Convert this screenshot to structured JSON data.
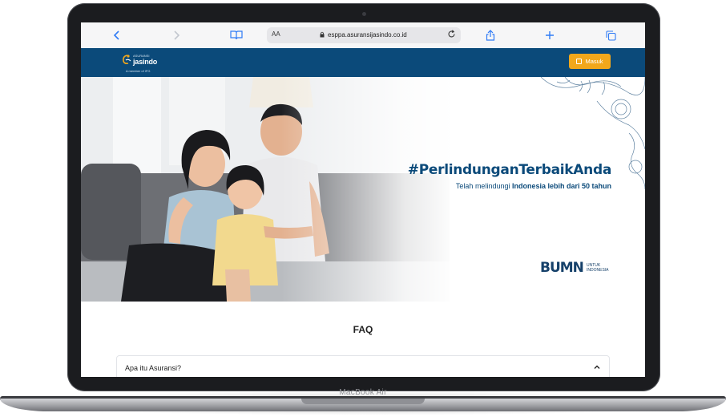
{
  "device": {
    "label": "MacBook Air"
  },
  "browser": {
    "aa_label": "AA",
    "url": "esppa.asuransijasindo.co.id",
    "icons": [
      "back-icon",
      "forward-icon",
      "bookmarks-icon",
      "reload-icon",
      "share-icon",
      "new-tab-icon",
      "tabs-icon"
    ]
  },
  "site": {
    "logo": {
      "top_text": "ASURANSI",
      "word": "jasindo",
      "sub": "A member of IFG"
    },
    "masuk_label": "Masuk",
    "colors": {
      "header": "#0b4a7a",
      "accent": "#f2a71b"
    }
  },
  "hero": {
    "headline": "#PerlindunganTerbaikAnda",
    "sub_prefix": "Telah melindungi ",
    "sub_bold": "Indonesia lebih dari 50 tahun",
    "bumn_word": "BUMN",
    "bumn_tag": "UNTUK INDONESIA"
  },
  "faq": {
    "title": "FAQ",
    "items": [
      {
        "question": "Apa itu Asuransi?"
      }
    ]
  }
}
